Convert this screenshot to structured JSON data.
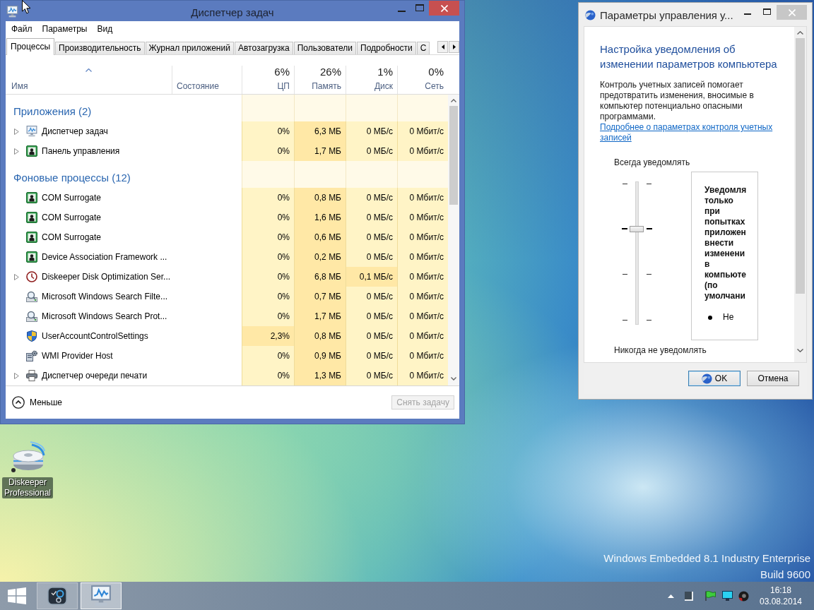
{
  "desktop": {
    "icons": [
      {
        "label": "Diskeeper Professional"
      }
    ],
    "watermark": [
      "Windows Embedded 8.1 Industry Enterprise",
      "Build 9600"
    ]
  },
  "task_manager": {
    "title": "Диспетчер задач",
    "menu": [
      "Файл",
      "Параметры",
      "Вид"
    ],
    "tabs": [
      {
        "label": "Процессы",
        "selected": true
      },
      {
        "label": "Производительность",
        "selected": false
      },
      {
        "label": "Журнал приложений",
        "selected": false
      },
      {
        "label": "Автозагрузка",
        "selected": false
      },
      {
        "label": "Пользователи",
        "selected": false
      },
      {
        "label": "Подробности",
        "selected": false
      },
      {
        "label": "С",
        "selected": false
      }
    ],
    "columns": [
      {
        "label": "Имя",
        "sorted": true
      },
      {
        "label": "Состояние",
        "sorted": false
      },
      {
        "label": "ЦП",
        "total": "6%",
        "sorted": false
      },
      {
        "label": "Память",
        "total": "26%",
        "sorted": false
      },
      {
        "label": "Диск",
        "total": "1%",
        "sorted": false
      },
      {
        "label": "Сеть",
        "total": "0%",
        "sorted": false
      }
    ],
    "groups": [
      {
        "title": "Приложения (2)",
        "rows": [
          {
            "name": "Диспетчер задач",
            "kind": "monitor",
            "expandable": true,
            "cells": [
              {
                "text": "0%",
                "highlighted": false
              },
              {
                "text": "6,3 МБ",
                "highlighted": true
              },
              {
                "text": "0 МБ/с",
                "highlighted": false
              },
              {
                "text": "0 Мбит/с",
                "highlighted": false
              }
            ]
          },
          {
            "name": "Панель управления",
            "kind": "app",
            "expandable": true,
            "cells": [
              {
                "text": "0%",
                "highlighted": false
              },
              {
                "text": "1,7 МБ",
                "highlighted": true
              },
              {
                "text": "0 МБ/с",
                "highlighted": false
              },
              {
                "text": "0 Мбит/с",
                "highlighted": false
              }
            ]
          }
        ]
      },
      {
        "title": "Фоновые процессы (12)",
        "rows": [
          {
            "name": "COM Surrogate",
            "kind": "app",
            "expandable": false,
            "cells": [
              {
                "text": "0%",
                "highlighted": false
              },
              {
                "text": "0,8 МБ",
                "highlighted": true
              },
              {
                "text": "0 МБ/с",
                "highlighted": false
              },
              {
                "text": "0 Мбит/с",
                "highlighted": false
              }
            ]
          },
          {
            "name": "COM Surrogate",
            "kind": "app",
            "expandable": false,
            "cells": [
              {
                "text": "0%",
                "highlighted": false
              },
              {
                "text": "1,6 МБ",
                "highlighted": true
              },
              {
                "text": "0 МБ/с",
                "highlighted": false
              },
              {
                "text": "0 Мбит/с",
                "highlighted": false
              }
            ]
          },
          {
            "name": "COM Surrogate",
            "kind": "app",
            "expandable": false,
            "cells": [
              {
                "text": "0%",
                "highlighted": false
              },
              {
                "text": "0,6 МБ",
                "highlighted": true
              },
              {
                "text": "0 МБ/с",
                "highlighted": false
              },
              {
                "text": "0 Мбит/с",
                "highlighted": false
              }
            ]
          },
          {
            "name": "Device Association Framework ...",
            "kind": "app",
            "expandable": false,
            "cells": [
              {
                "text": "0%",
                "highlighted": false
              },
              {
                "text": "0,2 МБ",
                "highlighted": true
              },
              {
                "text": "0 МБ/с",
                "highlighted": false
              },
              {
                "text": "0 Мбит/с",
                "highlighted": false
              }
            ]
          },
          {
            "name": "Diskeeper Disk Optimization Ser...",
            "kind": "clock",
            "expandable": true,
            "cells": [
              {
                "text": "0%",
                "highlighted": false
              },
              {
                "text": "6,8 МБ",
                "highlighted": true
              },
              {
                "text": "0,1 МБ/с",
                "highlighted": true
              },
              {
                "text": "0 Мбит/с",
                "highlighted": false
              }
            ]
          },
          {
            "name": "Microsoft Windows Search Filte...",
            "kind": "magnifier",
            "expandable": false,
            "cells": [
              {
                "text": "0%",
                "highlighted": false
              },
              {
                "text": "0,7 МБ",
                "highlighted": true
              },
              {
                "text": "0 МБ/с",
                "highlighted": false
              },
              {
                "text": "0 Мбит/с",
                "highlighted": false
              }
            ]
          },
          {
            "name": "Microsoft Windows Search Prot...",
            "kind": "magnifier",
            "expandable": false,
            "cells": [
              {
                "text": "0%",
                "highlighted": false
              },
              {
                "text": "1,7 МБ",
                "highlighted": true
              },
              {
                "text": "0 МБ/с",
                "highlighted": false
              },
              {
                "text": "0 Мбит/с",
                "highlighted": false
              }
            ]
          },
          {
            "name": "UserAccountControlSettings",
            "kind": "shield",
            "expandable": false,
            "cells": [
              {
                "text": "2,3%",
                "highlighted": true
              },
              {
                "text": "0,8 МБ",
                "highlighted": true
              },
              {
                "text": "0 МБ/с",
                "highlighted": false
              },
              {
                "text": "0 Мбит/с",
                "highlighted": false
              }
            ]
          },
          {
            "name": "WMI Provider Host",
            "kind": "server",
            "expandable": false,
            "cells": [
              {
                "text": "0%",
                "highlighted": false
              },
              {
                "text": "0,9 МБ",
                "highlighted": true
              },
              {
                "text": "0 МБ/с",
                "highlighted": false
              },
              {
                "text": "0 Мбит/с",
                "highlighted": false
              }
            ]
          },
          {
            "name": "Диспетчер очереди печати",
            "kind": "printer",
            "expandable": true,
            "cells": [
              {
                "text": "0%",
                "highlighted": false
              },
              {
                "text": "1,3 МБ",
                "highlighted": true
              },
              {
                "text": "0 МБ/с",
                "highlighted": false
              },
              {
                "text": "0 Мбит/с",
                "highlighted": false
              }
            ]
          }
        ]
      }
    ],
    "footer": {
      "details_toggle": "Меньше",
      "end_task": {
        "label": "Снять задачу",
        "disabled": true
      }
    }
  },
  "uac": {
    "title": "Параметры управления у...",
    "heading": "Настройка уведомления об изменении параметров компьютера",
    "description": "Контроль учетных записей помогает предотвратить изменения, вносимые в компьютер потенциально опасными программами.",
    "link": "Подробнее о параметрах контроля учетных записей",
    "slider": {
      "top_label": "Всегда уведомлять",
      "bottom_label": "Никогда не уведомлять",
      "level": 0.667
    },
    "info": {
      "summary": "Уведомля только при попытках приложен внести изменени в компьюте (по умолчани",
      "bullets": [
        "Не"
      ]
    },
    "buttons": [
      {
        "label": "OK",
        "default": true,
        "elevated": true
      },
      {
        "label": "Отмена",
        "default": false,
        "elevated": false
      }
    ]
  },
  "taskbar": {
    "buttons": [
      {
        "kind": "gauges",
        "selected": false
      },
      {
        "kind": "monitor",
        "selected": true
      }
    ],
    "clock": {
      "time": "16:18",
      "date": "03.08.2014"
    }
  }
}
